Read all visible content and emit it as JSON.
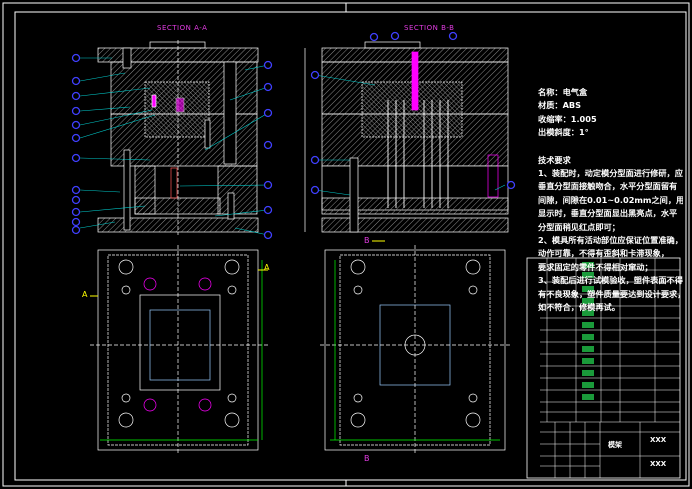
{
  "sections": {
    "a_title": "SECTION A-A",
    "b_title": "SECTION B-B"
  },
  "cut_labels": {
    "a_left": "A",
    "a_right": "A",
    "b_top": "B",
    "b_bottom": "B"
  },
  "notes": {
    "name": "名称：电气盒",
    "material": "材质：ABS",
    "shrinkage": "收缩率：1.005",
    "draft": "出模斜度：1°",
    "heading": "技术要求",
    "lines": [
      "1、装配时，动定模分型面进行修研，应使",
      "垂直分型面接触吻合，水平分型面留有",
      "间隙，间隙在0.01~0.02mm之间，用红丹",
      "显示时，垂直分型面显出黑亮点，水平",
      "分型面稍见红点即可；",
      "2、模具所有活动部位应保证位置准确，",
      "动作可靠，不得有歪斜和卡滞现象，",
      "要求固定的零件不得相对窜动；",
      "3、装配后进行试模验收，塑件表面不得",
      "有不良现象，塑件质量要达到设计要求，",
      "如不符合，修模再试。"
    ]
  },
  "title_block": {
    "drawing_name": "模架",
    "code_1": "XXX",
    "code_2": "XXX"
  },
  "colors": {
    "background": "#000000",
    "lines": "#ffffff",
    "balloons": "#3a3aff",
    "leaders": "#00d0d0",
    "ejector": "#ff00ff",
    "dimension": "#00ff00",
    "cut_line": "#ffff00"
  }
}
